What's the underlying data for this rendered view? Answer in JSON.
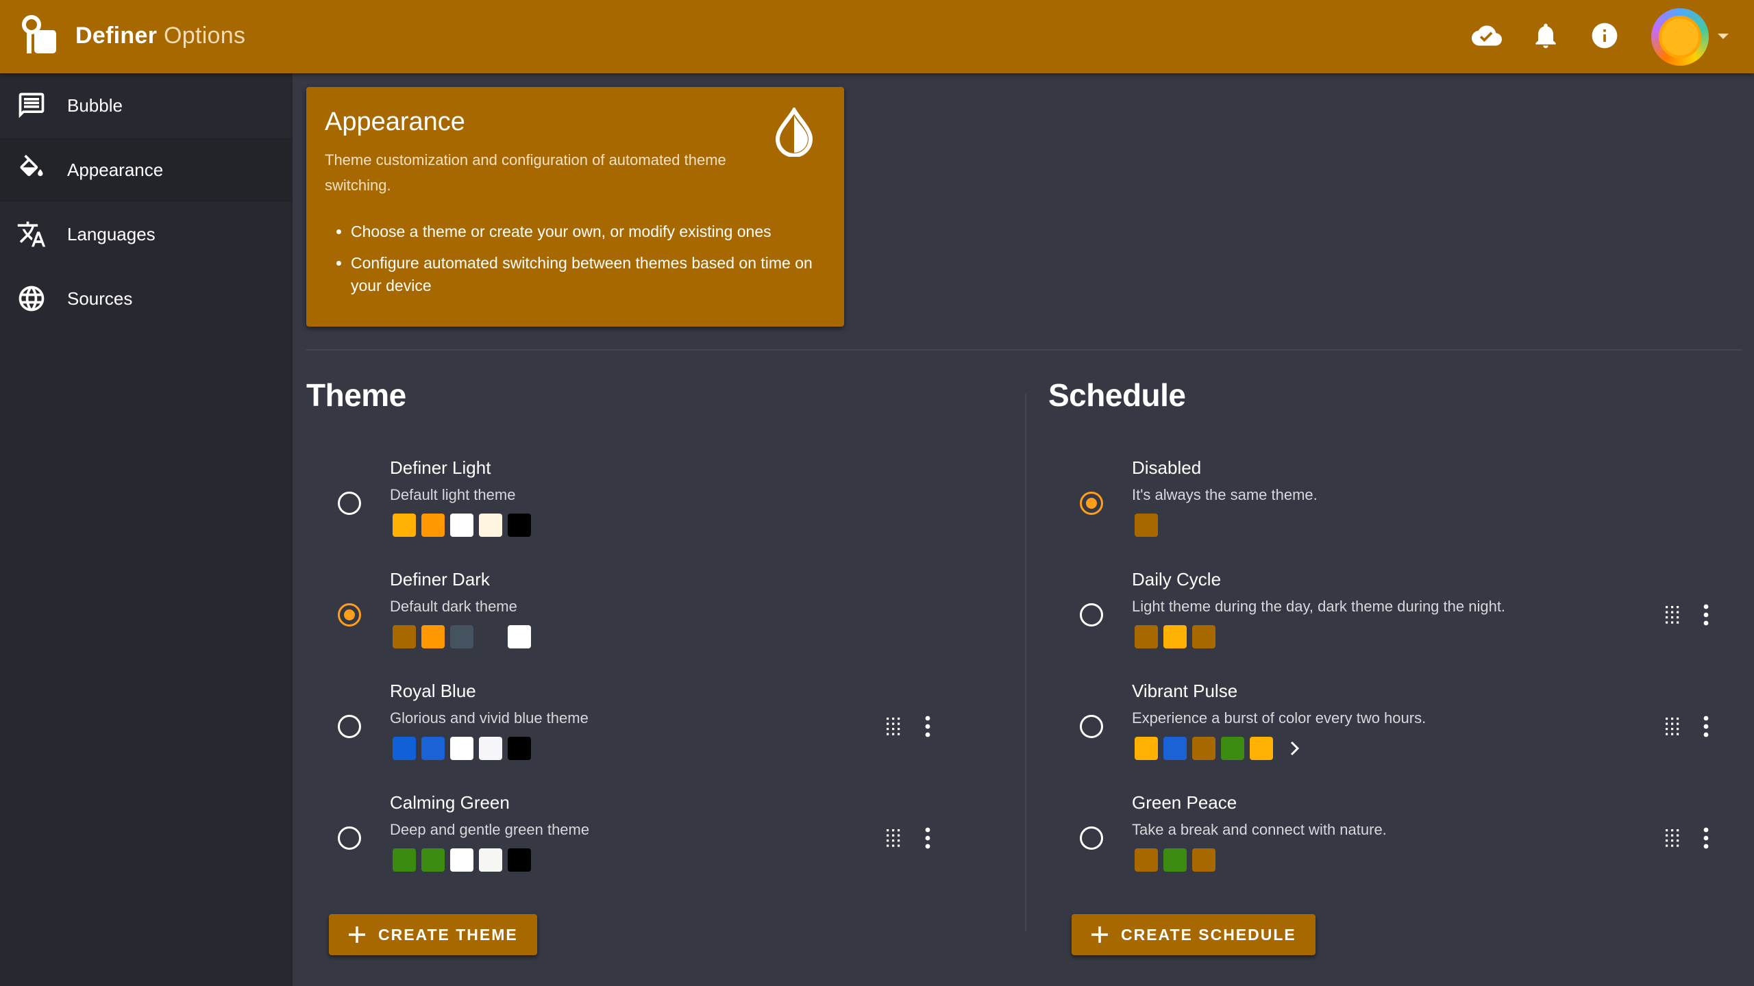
{
  "app": {
    "title_main": "Definer",
    "title_sub": "Options"
  },
  "sidebar": {
    "items": [
      {
        "label": "Bubble"
      },
      {
        "label": "Appearance",
        "active": true
      },
      {
        "label": "Languages"
      },
      {
        "label": "Sources"
      }
    ]
  },
  "info_card": {
    "title": "Appearance",
    "description": "Theme customization and configuration of automated theme switching.",
    "bullets": [
      "Choose a theme or create your own, or modify existing ones",
      "Configure automated switching between themes based on time on your device"
    ]
  },
  "theme": {
    "title": "Theme",
    "items": [
      {
        "name": "Definer Light",
        "desc": "Default light theme",
        "checked": false,
        "colors": [
          "#ffb000",
          "#ff9800",
          "#ffffff",
          "#fff5e1",
          "#000000"
        ]
      },
      {
        "name": "Definer Dark",
        "desc": "Default dark theme",
        "checked": true,
        "colors": [
          "#a86800",
          "#ff9800",
          "#455260",
          "#363843",
          "#ffffff"
        ]
      },
      {
        "name": "Royal Blue",
        "desc": "Glorious and vivid blue theme",
        "checked": false,
        "colors": [
          "#1060d8",
          "#1a63d6",
          "#ffffff",
          "#f5f5fa",
          "#000000"
        ]
      },
      {
        "name": "Calming Green",
        "desc": "Deep and gentle green theme",
        "checked": false,
        "colors": [
          "#3a8a10",
          "#3d8c12",
          "#ffffff",
          "#f6f6f2",
          "#000000"
        ]
      }
    ],
    "button_label": "CREATE THEME"
  },
  "schedule": {
    "title": "Schedule",
    "items": [
      {
        "name": "Disabled",
        "desc": "It's always the same theme.",
        "checked": true,
        "colors": [
          "#a86800"
        ]
      },
      {
        "name": "Daily Cycle",
        "desc": "Light theme during the day, dark theme during the night.",
        "checked": false,
        "colors": [
          "#a86800",
          "#ffb000",
          "#a86800"
        ]
      },
      {
        "name": "Vibrant Pulse",
        "desc": "Experience a burst of color every two hours.",
        "checked": false,
        "colors": [
          "#ffb000",
          "#1a63d6",
          "#a86800",
          "#3d8c12",
          "#ffb000"
        ]
      },
      {
        "name": "Green Peace",
        "desc": "Take a break and connect with nature.",
        "checked": false,
        "colors": [
          "#a86800",
          "#3d8c12",
          "#a86800"
        ]
      }
    ],
    "button_label": "CREATE SCHEDULE"
  },
  "colors": {
    "accent": "#a86800",
    "accent_bright": "#ff9e1a",
    "background": "#363843",
    "sidebar": "#282930"
  },
  "icons": {
    "logo": "definer-logo-icon",
    "topbar": [
      "cloud-done-icon",
      "bell-icon",
      "info-icon"
    ],
    "sidebar": [
      "message-square-icon",
      "paint-bucket-icon",
      "translate-icon",
      "globe-icon"
    ]
  }
}
